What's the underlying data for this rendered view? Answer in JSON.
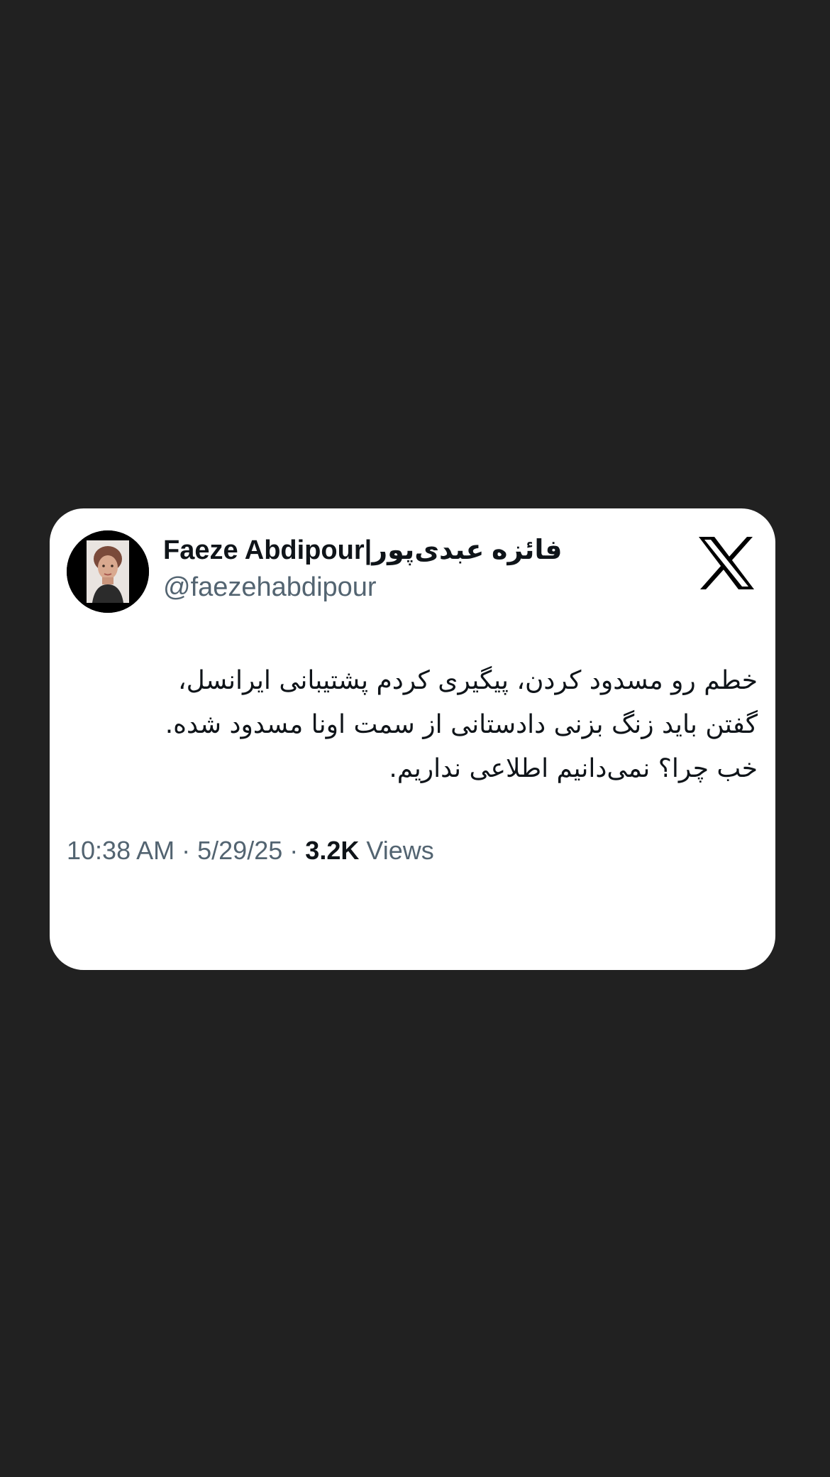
{
  "tweet": {
    "author": {
      "display_name": "Faeze Abdipour|فائزه عبدی‌پور",
      "handle": "@faezehabdipour",
      "avatar_icon": "profile-photo"
    },
    "platform_icon": "x-logo-icon",
    "text_lines": [
      "خطم رو مسدود کردن، پیگیری کردم پشتیبانی ایرانسل،",
      "گفتن باید زنگ بزنی دادستانی از سمت اونا مسدود شده.",
      "خب چرا؟ نمی‌دانیم اطلاعی نداریم."
    ],
    "time": "10:38 AM",
    "separator": "·",
    "date": "5/29/25",
    "views_count": "3.2K",
    "views_label": "Views"
  },
  "colors": {
    "background": "#212121",
    "card": "#ffffff",
    "primary_text": "#0f1419",
    "secondary_text": "#536471"
  }
}
